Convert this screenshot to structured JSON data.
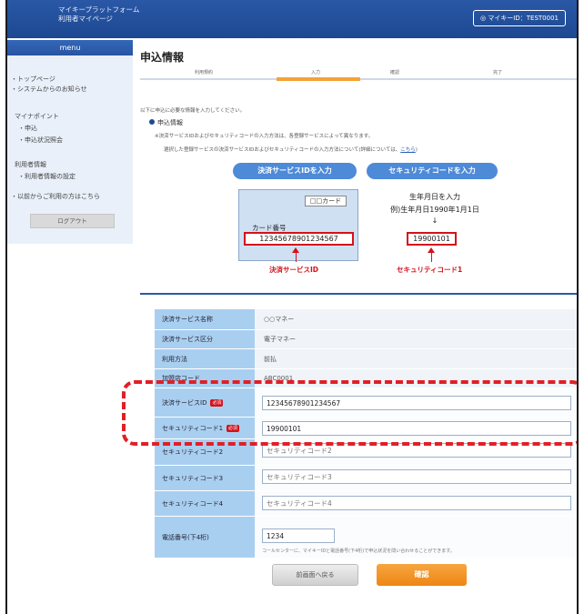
{
  "header": {
    "brand_line1": "マイキープラットフォーム",
    "brand_line2": "利用者マイページ",
    "user_id": "マイキーID：TEST0001"
  },
  "sidebar": {
    "menu_title": "menu",
    "items": [
      {
        "label": "・トップページ"
      },
      {
        "label": "・システムからのお知らせ"
      },
      {
        "label": "マイナポイント"
      },
      {
        "label": "・申込"
      },
      {
        "label": "・申込状況照会"
      },
      {
        "label": "利用者情報"
      },
      {
        "label": "・利用者情報の設定"
      },
      {
        "label": "・以前からご利用の方はこちら"
      }
    ],
    "logout_label": "ログアウト"
  },
  "main": {
    "title": "申込情報",
    "steps": [
      "利用規約",
      "入力",
      "確認",
      "完了"
    ],
    "active_step": 1,
    "intro": "以下に申込に必要な情報を入力してください。",
    "section_title": "申込情報",
    "note1": "※決済サービスIDおよびセキュリティコードの入力方法は、各登録サービスによって異なります。",
    "note2": "選択した登録サービスの決済サービスIDおよびセキュリティコードの入力方法について(詳細については、",
    "note2_link": "こちら",
    "note2_end": ")"
  },
  "guide": {
    "id_button": "決済サービスIDを入力",
    "code_button": "セキュリティコードを入力",
    "card_tag": "□□カード",
    "card_no_label": "カード番号",
    "card_number": "12345678901234567",
    "id_caption": "決済サービスID",
    "birth_hint1": "生年月日を入力",
    "birth_hint2": "例)生年月日1990年1月1日",
    "birth_arrow": "↓",
    "code_value": "19900101",
    "code_caption": "セキュリティコード1"
  },
  "form": {
    "rows": [
      {
        "label": "決済サービス名称",
        "value": "○○マネー"
      },
      {
        "label": "決済サービス区分",
        "value": "電子マネー"
      },
      {
        "label": "利用方法",
        "value": "前払"
      },
      {
        "label": "加盟店コード",
        "value": "ABC0001"
      }
    ],
    "required_badge": "必須",
    "service_id_label": "決済サービスID",
    "service_id_value": "12345678901234567",
    "code1_label": "セキュリティコード1",
    "code1_value": "19900101",
    "code2_label": "セキュリティコード2",
    "code2_placeholder": "セキュリティコード2",
    "code3_label": "セキュリティコード3",
    "code3_placeholder": "セキュリティコード3",
    "code4_label": "セキュリティコード4",
    "code4_placeholder": "セキュリティコード4",
    "phone_label": "電話番号(下4桁)",
    "phone_value": "1234",
    "phone_note": "コールセンターに、マイキーIDと電話番号(下4桁)で申込状況を問い合わせることができます。"
  },
  "buttons": {
    "back": "前画面へ戻る",
    "confirm": "確認"
  },
  "colors": {
    "header": "#1d4892",
    "label_bg": "#a9cff0",
    "accent_orange": "#ee8614",
    "highlight_red": "#e11f26"
  }
}
